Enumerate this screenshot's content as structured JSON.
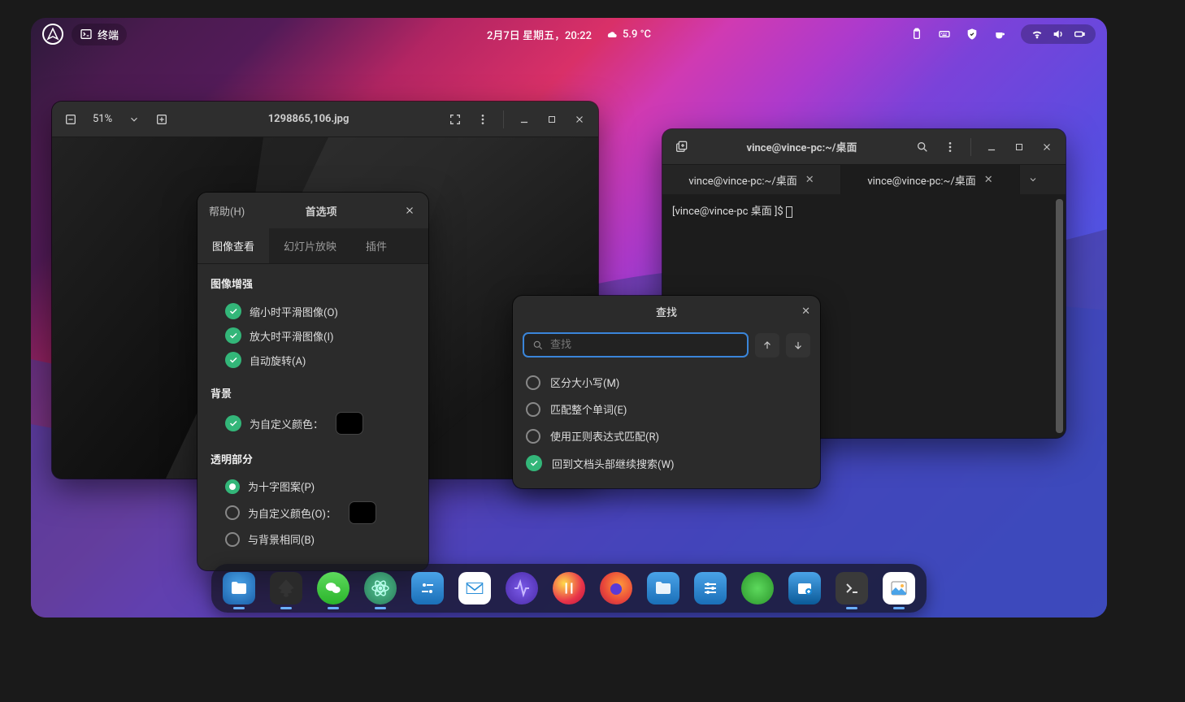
{
  "topbar": {
    "app_label": "终端",
    "datetime": "2月7日 星期五，20:22",
    "temp": "5.9 °C"
  },
  "imgviewer": {
    "zoom": "51%",
    "filename": "1298865,106.jpg"
  },
  "prefs": {
    "help_label": "帮助(H)",
    "title": "首选项",
    "tabs": {
      "view": "图像查看",
      "slideshow": "幻灯片放映",
      "plugins": "插件"
    },
    "section_enhance": "图像增强",
    "opt_shrink": "缩小时平滑图像(O)",
    "opt_expand": "放大时平滑图像(I)",
    "opt_autorotate": "自动旋转(A)",
    "section_bg": "背景",
    "opt_customcolor": "为自定义颜色：",
    "section_trans": "透明部分",
    "opt_pattern": "为十字图案(P)",
    "opt_customcolor2": "为自定义颜色(O)：",
    "opt_samebg": "与背景相同(B)"
  },
  "terminal": {
    "title": "vince@vince-pc:~/桌面",
    "tab1": "vince@vince-pc:~/桌面",
    "tab2": "vince@vince-pc:~/桌面",
    "prompt": "[vince@vince-pc 桌面 ]$ "
  },
  "search": {
    "title": "查找",
    "placeholder": "查找",
    "opt_case": "区分大小写(M)",
    "opt_word": "匹配整个单词(E)",
    "opt_regex": "使用正则表达式匹配(R)",
    "opt_wrap": "回到文档头部继续搜索(W)"
  }
}
